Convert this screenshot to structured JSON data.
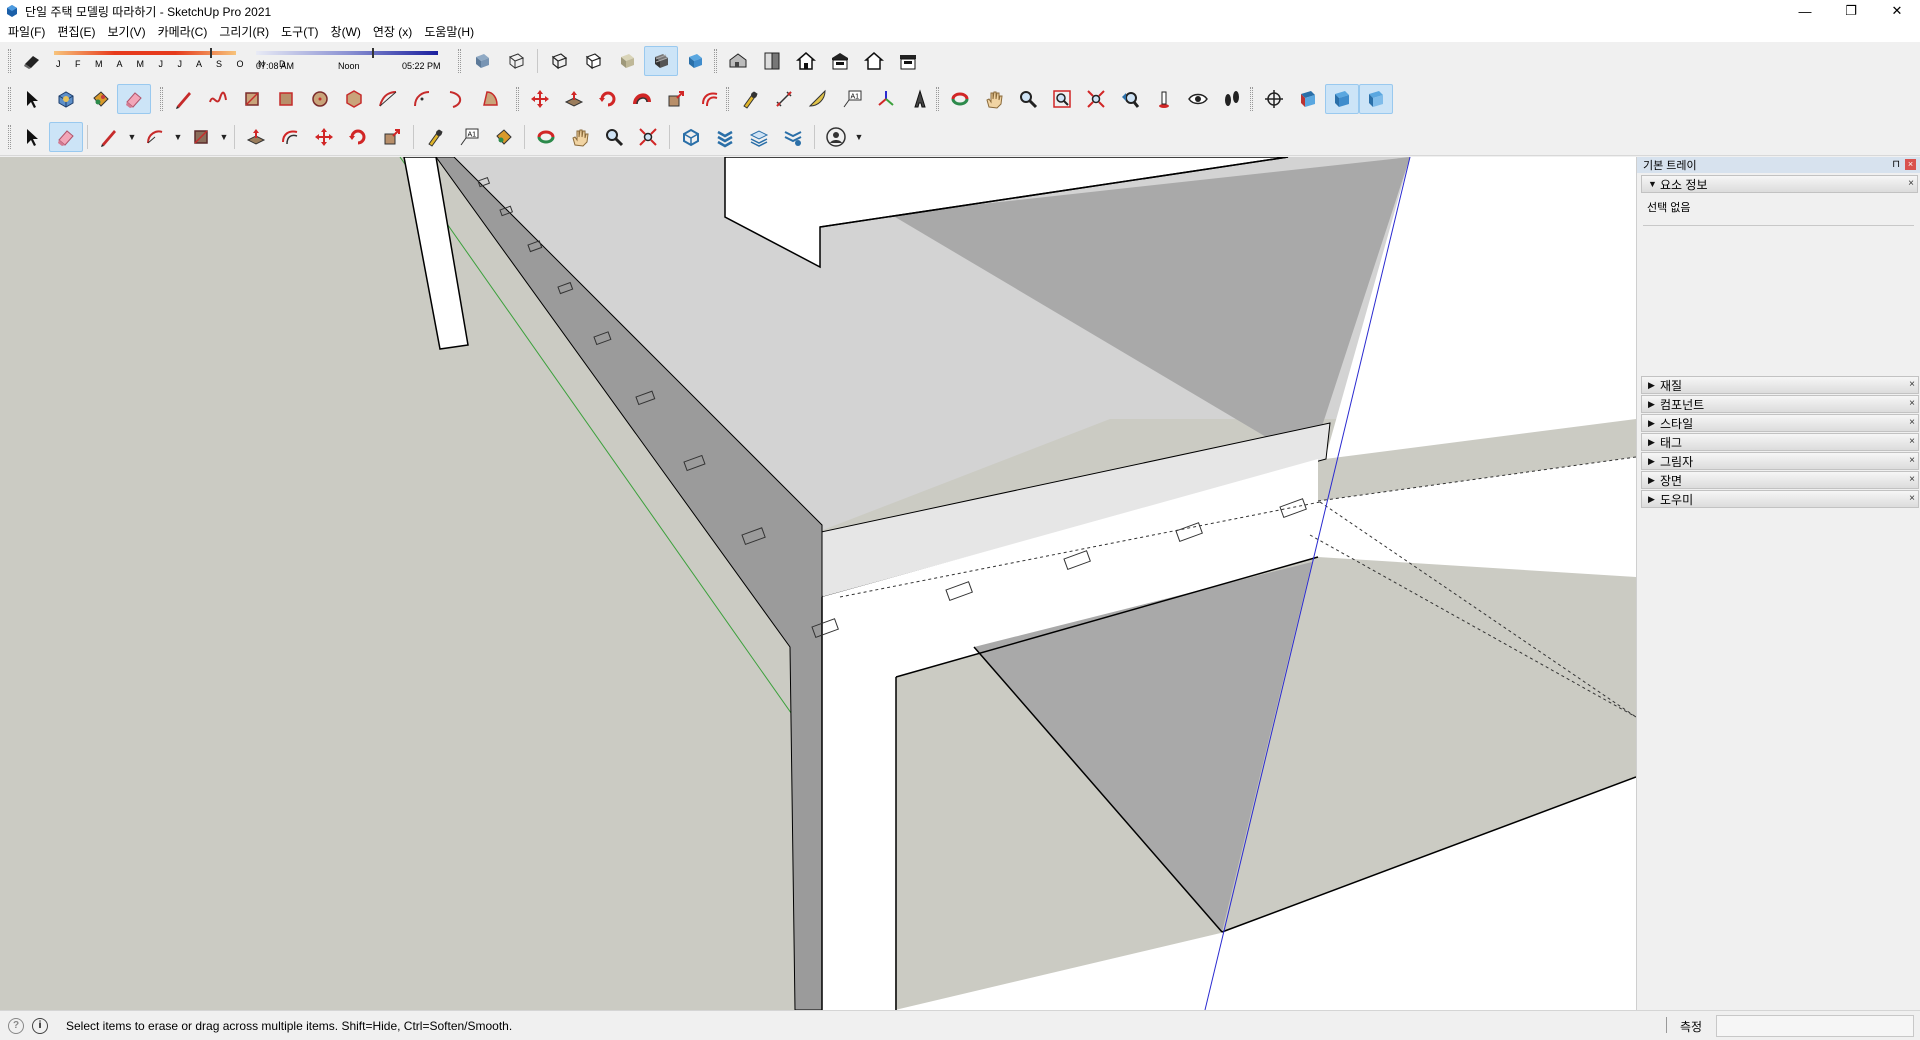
{
  "window": {
    "title": "단일 주택 모델링 따라하기 - SketchUp Pro 2021",
    "controls": {
      "minimize": "—",
      "restore": "❐",
      "close": "✕"
    }
  },
  "menu": [
    "파일(F)",
    "편집(E)",
    "보기(V)",
    "카메라(C)",
    "그리기(R)",
    "도구(T)",
    "창(W)",
    "연장 (x)",
    "도움말(H)"
  ],
  "shadow_settings": {
    "months": "J F M A M J J A S O N D",
    "time_start": "07:08 AM",
    "time_mid": "Noon",
    "time_end": "05:22 PM"
  },
  "toolbars": {
    "row1": [
      "eraser-tool",
      "xray-style",
      "back-edges-style",
      "wireframe-style",
      "hidden-line-style",
      "shaded-style",
      "shaded-textures-style",
      "monochrome-style",
      "iso-view",
      "top-view",
      "front-view",
      "right-view",
      "back-view",
      "left-view"
    ],
    "row2": [
      "select",
      "make-component",
      "paint-bucket",
      "eraser",
      "line",
      "freehand",
      "rectangle",
      "rotated-rectangle",
      "circle",
      "polygon",
      "arc",
      "two-point-arc",
      "three-point-arc",
      "pie",
      "move",
      "push-pull",
      "rotate",
      "follow-me",
      "scale",
      "offset",
      "tape-measure",
      "dimension",
      "protractor",
      "text",
      "axes",
      "3d-text",
      "orbit",
      "pan",
      "zoom",
      "zoom-window",
      "zoom-extents",
      "previous",
      "position-camera",
      "look-around",
      "walk",
      "section-plane",
      "display-section-planes",
      "display-section-cuts",
      "display-section-fill"
    ],
    "row3": [
      "select",
      "eraser",
      "line",
      "arc",
      "rectangle",
      "push-pull",
      "offset",
      "move",
      "rotate",
      "scale",
      "tape-measure",
      "text",
      "paint-bucket",
      "orbit",
      "pan",
      "zoom",
      "zoom-extents",
      "warehouse",
      "extension-warehouse",
      "share-model",
      "layout",
      "account"
    ]
  },
  "tray": {
    "title": "기본 트레이",
    "entity_info": {
      "header": "요소 정보",
      "body": "선택 없음"
    },
    "panels": [
      "재질",
      "컴포넌트",
      "스타일",
      "태그",
      "그림자",
      "장면",
      "도우미"
    ]
  },
  "status": {
    "message": "Select items to erase or drag across multiple items. Shift=Hide, Ctrl=Soften/Smooth.",
    "measurement_label": "측정",
    "measurement_value": ""
  },
  "colors": {
    "viewport_bg": "#cbcbc3",
    "face_white": "#ffffff",
    "face_gray": "#a9a9a9",
    "roof_light": "#d4d4d4",
    "axis_blue": "#2a2ad0",
    "axis_green": "#3ba03b",
    "active_tool": "#cce4f7"
  }
}
